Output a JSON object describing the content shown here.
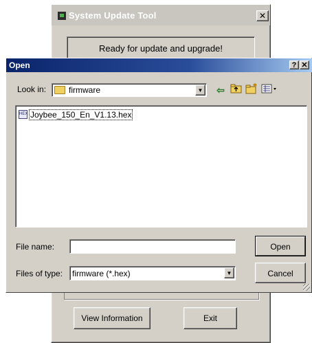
{
  "background_window": {
    "title": "System Update Tool",
    "close_glyph": "✕",
    "status": "Ready for update and upgrade!",
    "buttons": {
      "view_information": "View Information",
      "exit": "Exit"
    }
  },
  "open_dialog": {
    "title": "Open",
    "help_glyph": "?",
    "close_glyph": "✕",
    "look_in": {
      "label": "Look in:",
      "value": "firmware"
    },
    "files": [
      {
        "name": "Joybee_150_En_V1.13.hex"
      }
    ],
    "file_name": {
      "label": "File name:",
      "value": ""
    },
    "files_of_type": {
      "label": "Files of type:",
      "value": "firmware (*.hex)"
    },
    "buttons": {
      "open": "Open",
      "cancel": "Cancel"
    }
  },
  "icons": [
    "app-icon",
    "folder-icon",
    "back-icon",
    "up-folder-icon",
    "new-folder-icon",
    "view-menu-icon",
    "hex-file-icon",
    "chevron-down-icon"
  ],
  "colors": {
    "title_bar_active": "#0a246a",
    "title_bar_inactive": "#c9c6c0",
    "dialog_face": "#d4d0c8"
  }
}
